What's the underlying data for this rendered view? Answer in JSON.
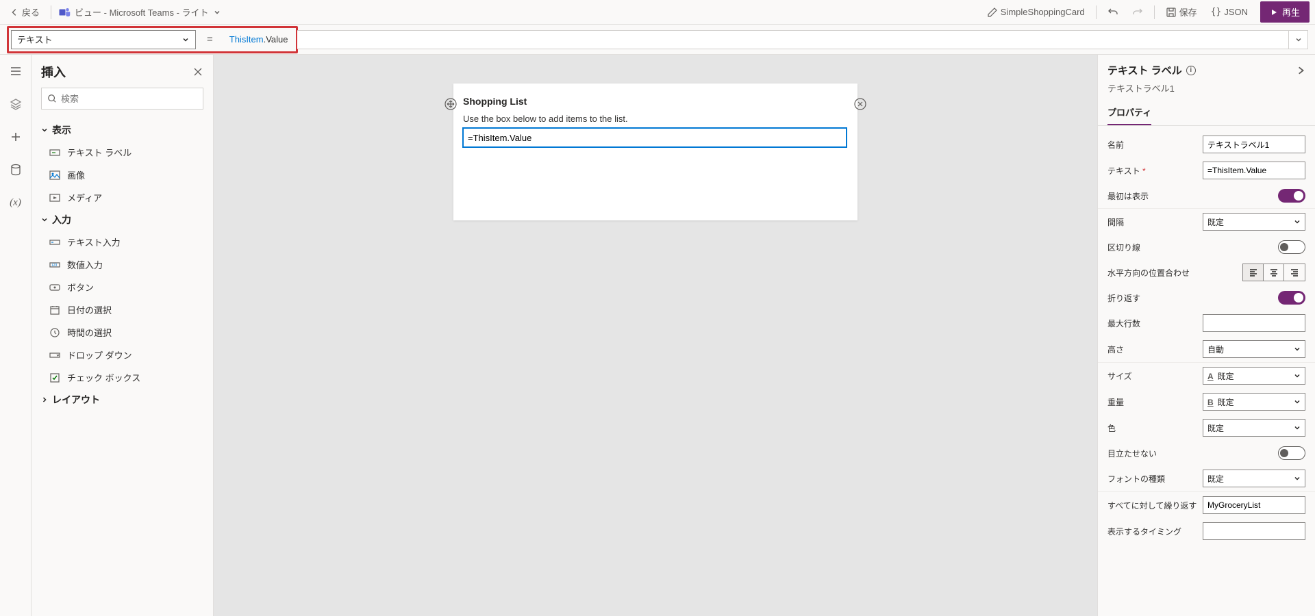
{
  "topbar": {
    "back": "戻る",
    "view_title": "ビュー - Microsoft Teams - ライト",
    "solution": "SimpleShoppingCard",
    "save": "保存",
    "json": "JSON",
    "play": "再生"
  },
  "formula": {
    "property": "テキスト",
    "kw": "ThisItem",
    "suffix": ".Value"
  },
  "insert": {
    "title": "挿入",
    "search_ph": "検索",
    "cat_display": "表示",
    "cat_input": "入力",
    "cat_layout": "レイアウト",
    "items_display": [
      "テキスト ラベル",
      "画像",
      "メディア"
    ],
    "items_input": [
      "テキスト入力",
      "数値入力",
      "ボタン",
      "日付の選択",
      "時間の選択",
      "ドロップ ダウン",
      "チェック ボックス"
    ]
  },
  "canvas": {
    "card_title": "Shopping List",
    "card_sub": "Use the box below to add items to the list.",
    "sel_value": "=ThisItem.Value"
  },
  "props": {
    "title": "テキスト ラベル",
    "instance": "テキストラベル1",
    "tab": "プロパティ",
    "rows": {
      "name": {
        "label": "名前",
        "value": "テキストラベル1"
      },
      "text": {
        "label": "テキスト",
        "value": "=ThisItem.Value"
      },
      "visible_init": {
        "label": "最初は表示"
      },
      "spacing": {
        "label": "間隔",
        "value": "既定"
      },
      "divider": {
        "label": "区切り線"
      },
      "halign": {
        "label": "水平方向の位置合わせ"
      },
      "wrap": {
        "label": "折り返す"
      },
      "maxlines": {
        "label": "最大行数",
        "value": ""
      },
      "height": {
        "label": "高さ",
        "value": "自動"
      },
      "size": {
        "label": "サイズ",
        "value": "既定"
      },
      "weight": {
        "label": "重量",
        "value": "既定"
      },
      "color": {
        "label": "色",
        "value": "既定"
      },
      "subtle": {
        "label": "目立たせない"
      },
      "font": {
        "label": "フォントの種類",
        "value": "既定"
      },
      "repeat": {
        "label": "すべてに対して繰り返す",
        "value": "MyGroceryList"
      },
      "show_when": {
        "label": "表示するタイミング",
        "value": ""
      }
    }
  }
}
